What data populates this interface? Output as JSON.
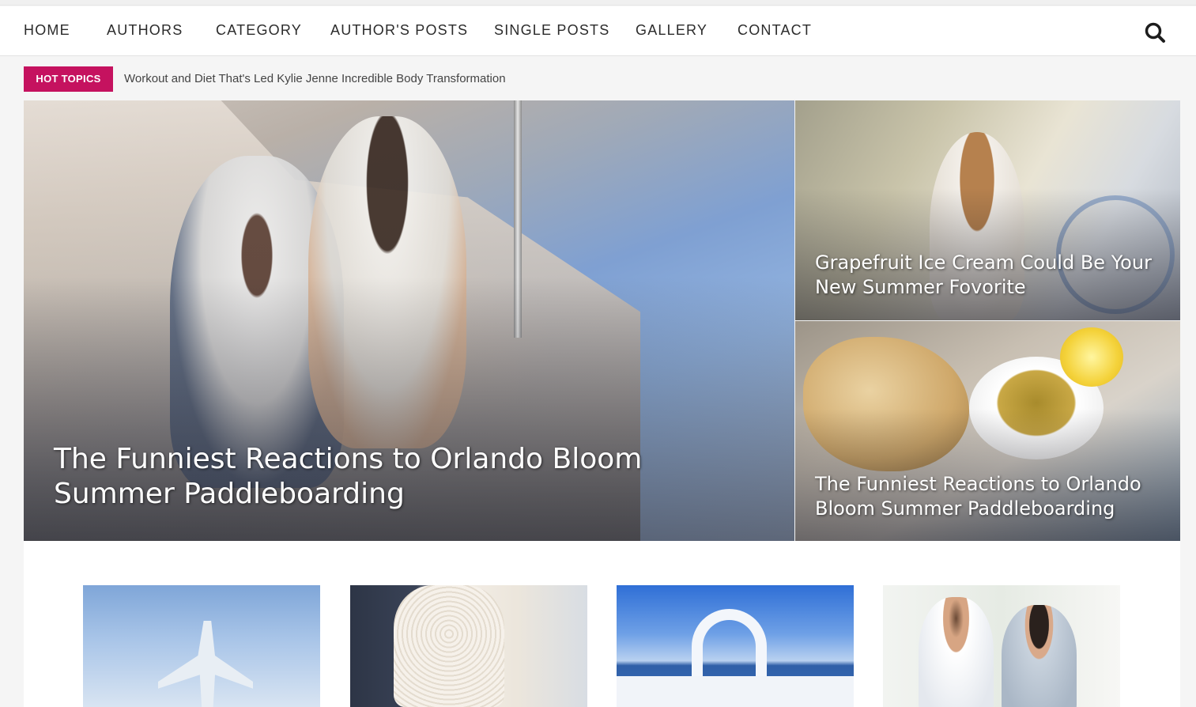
{
  "nav": {
    "items": [
      {
        "label": "HOME"
      },
      {
        "label": "AUTHORS"
      },
      {
        "label": "CATEGORY"
      },
      {
        "label": "AUTHOR'S POSTS"
      },
      {
        "label": "SINGLE POSTS"
      },
      {
        "label": "GALLERY"
      },
      {
        "label": "CONTACT"
      }
    ],
    "search_icon": "search-icon"
  },
  "hot_topics": {
    "badge": "HOT TOPICS",
    "headline": "Workout and Diet That's Led Kylie Jenne Incredible Body Transformation"
  },
  "featured": {
    "main": {
      "title": "The Funniest Reactions to Orlando Bloom Summer Paddleboarding"
    },
    "side": [
      {
        "title": "Grapefruit Ice Cream Could Be Your New Summer Fovorite"
      },
      {
        "title": "The Funniest Reactions to Orlando Bloom Summer Paddleboarding"
      }
    ]
  },
  "colors": {
    "accent": "#c5125f",
    "nav_text": "#2b2b2b",
    "background": "#f5f5f5"
  }
}
